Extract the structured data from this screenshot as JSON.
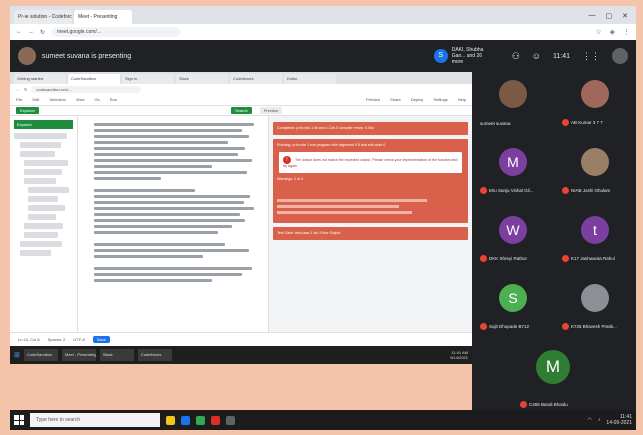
{
  "browser": {
    "tabs": [
      "Pr-ie solution - Codeforces",
      "Meet - Presenting"
    ],
    "url": "meet.google.com/...",
    "window_controls": [
      "—",
      "▢",
      "✕"
    ]
  },
  "meet": {
    "presenter": "sumeet suvana is presenting",
    "pinned_name": "DAKI, Shubha Gan... and 26 more",
    "pinned_initial": "S",
    "time": "11:41"
  },
  "shared_screen": {
    "tabs": [
      "Getting started",
      "CodeSandbox",
      "Sign in",
      "Slack",
      "Codeforces",
      "Editor"
    ],
    "url": "codesandbox.io/s/...",
    "toolbar_items": [
      "File",
      "Edit",
      "Selection",
      "View",
      "Go",
      "Run"
    ],
    "toolbar_right": [
      "Preview",
      "Share",
      "Deploy",
      "Settings",
      "Help"
    ],
    "buttons": {
      "primary": "Explorer",
      "secondary": "Search",
      "preview": "Preview"
    },
    "tree_header": "Explorer",
    "cards": [
      "Completed: pr4c.min.1.lib and c.1.lib.0 compiler errors: 0.04s",
      "Running: pr4c.min.1.exe program with argument 0.0 and exit code 0",
      "Warnings: 1 of 4",
      "Test Case: test-case-1.txt / Error Output"
    ],
    "white_card": "The output does not match the expected output. Please check your implementation of the function and try again.",
    "status": [
      "Ln 24, Col 8",
      "Spaces: 2",
      "UTF-8",
      "Save"
    ],
    "inner_taskbar": [
      "CodeSandbox",
      "Meet - Presenting",
      "Slack",
      "Codeforces"
    ],
    "inner_clock": [
      "11:41 AM",
      "9/14/2021"
    ]
  },
  "participants": [
    {
      "name": "sumeet suvana",
      "initial": "",
      "color": "#7a5a45",
      "photo": true
    },
    {
      "name": "AB Kumar 3 7 7",
      "initial": "",
      "color": "#a0685a",
      "photo": true
    },
    {
      "name": "Mru Sanju Vishal Gil...",
      "initial": "M",
      "color": "#7b3fa0",
      "photo": false
    },
    {
      "name": "NIAB Joshi Ghulam",
      "initial": "",
      "color": "#9a7f66",
      "photo": true
    },
    {
      "name": "DKK Shreyi Rathor",
      "initial": "W",
      "color": "#7b3fa0",
      "photo": false
    },
    {
      "name": "K17 Jashwanta Rahul",
      "initial": "t",
      "color": "#7b3fa0",
      "photo": false
    },
    {
      "name": "Sujit Dhopade B712",
      "initial": "S",
      "color": "#4caf50",
      "photo": false
    },
    {
      "name": "K726 Bhavesh Pratik...",
      "initial": "",
      "color": "#8c8f96",
      "photo": true
    },
    {
      "name": "C465 Bandi Bhaidu",
      "initial": "M",
      "color": "#2e7d32",
      "photo": false
    }
  ],
  "taskbar": {
    "search_placeholder": "Type here to search",
    "time": "11:41",
    "date": "14-09-2021"
  }
}
